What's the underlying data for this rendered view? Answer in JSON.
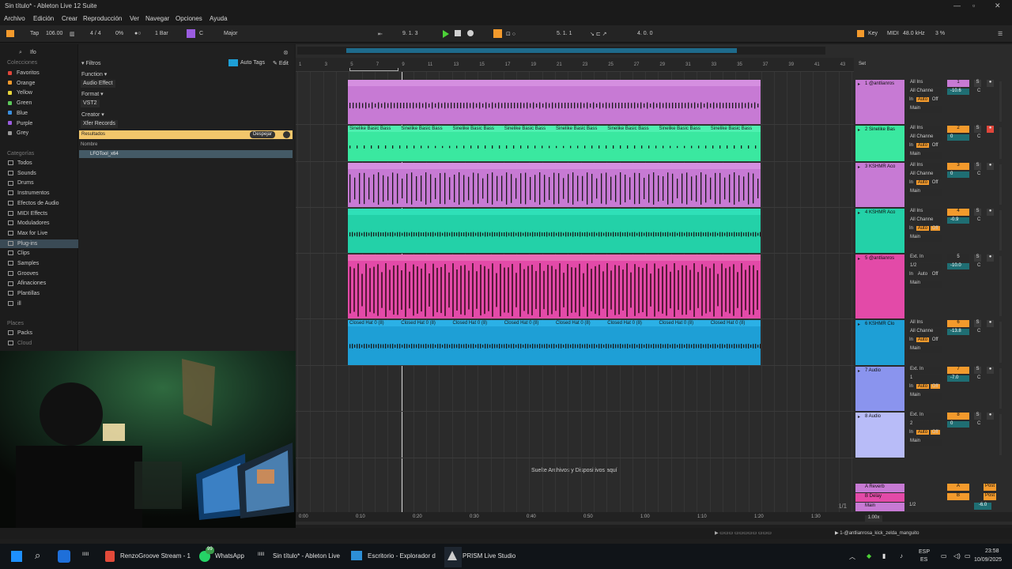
{
  "window": {
    "title": "Sin título* - Ableton Live 12 Suite"
  },
  "menu": [
    "Archivo",
    "Edición",
    "Crear",
    "Reproducción",
    "Ver",
    "Navegar",
    "Opciones",
    "Ayuda"
  ],
  "controlbar": {
    "tap": "Tap",
    "tempo": "106.00",
    "signature": "4 / 4",
    "metronome": "0%",
    "quantize": "1 Bar",
    "key": "C",
    "scale": "Major",
    "position": "9.  1.  3",
    "loop_start": "5.  1.  1",
    "loop_length": "4.  0.  0",
    "key_label": "Key",
    "midi_label": "MIDI",
    "sample_rate": "48.0 kHz",
    "cpu": "3 %"
  },
  "browser": {
    "search_placeholder": "Ifo",
    "collections_header": "Colecciones",
    "collections": [
      {
        "label": "Favoritos",
        "color": "#e0463a"
      },
      {
        "label": "Orange",
        "color": "#f39a2c"
      },
      {
        "label": "Yellow",
        "color": "#e8d43a"
      },
      {
        "label": "Green",
        "color": "#5cc85a"
      },
      {
        "label": "Blue",
        "color": "#3a8fe0"
      },
      {
        "label": "Purple",
        "color": "#9a5ce0"
      },
      {
        "label": "Grey",
        "color": "#9a9a9a"
      }
    ],
    "categories_header": "Categorías",
    "categories": [
      "Todos",
      "Sounds",
      "Drums",
      "Instrumentos",
      "Efectos de Audio",
      "MIDI Effects",
      "Moduladores",
      "Max for Live",
      "Plug-ins",
      "Clips",
      "Samples",
      "Grooves",
      "Afinaciones",
      "Plantillas",
      "ill"
    ],
    "selected_category": "Plug-ins",
    "places_header": "Places",
    "places": [
      "Packs",
      "Cloud"
    ],
    "filters_label": "Filtros",
    "auto_tags": "Auto Tags",
    "edit": "Edit",
    "filter_function": "Function",
    "filter_function_value": "Audio Effect",
    "filter_format": "Format",
    "filter_format_value": "VST2",
    "filter_creator": "Creator",
    "filter_creator_value": "Xfer Records",
    "results_label": "Resultados",
    "clear_button": "Despejar",
    "name_header": "Nombre",
    "result_item": "LFOTool_x64"
  },
  "ruler": [
    "1",
    "3",
    "5",
    "7",
    "9",
    "11",
    "13",
    "15",
    "17",
    "19",
    "21",
    "23",
    "25",
    "27",
    "29",
    "31",
    "33",
    "35",
    "37",
    "39",
    "41",
    "43"
  ],
  "tracks": [
    {
      "name": "1 @antlianros",
      "color": "#c77ad4",
      "input": "All Ins",
      "channel": "All Channe",
      "num": "1",
      "vol": "-10.6",
      "numColor": "#c77ad4",
      "clipLabel": ""
    },
    {
      "name": "2 Sinelike Bas",
      "color": "#3ae8a0",
      "input": "All Ins",
      "channel": "All Channe",
      "num": "2",
      "vol": "0",
      "numColor": "#f39a2c",
      "clipLabel": "Sinelike Basic Bass"
    },
    {
      "name": "3 KSHMR Aco",
      "color": "#c77ad4",
      "input": "All Ins",
      "channel": "All Channe",
      "num": "3",
      "vol": "0",
      "numColor": "#f39a2c",
      "clipLabel": ""
    },
    {
      "name": "4 KSHMR Aco",
      "color": "#23d1a8",
      "input": "All Ins",
      "channel": "All Channe",
      "num": "4",
      "vol": "-0.9",
      "numColor": "#f39a2c",
      "clipLabel": ""
    },
    {
      "name": "5 @antlianros",
      "color": "#e34aa8",
      "input": "Ext. In",
      "channel": "1/2",
      "num": "5",
      "vol": "-10.0",
      "numColor": "#2a2a2a",
      "clipLabel": ""
    },
    {
      "name": "6 KSHMR Clo",
      "color": "#1e9fd6",
      "input": "All Ins",
      "channel": "All Channe",
      "num": "6",
      "vol": "-13.8",
      "numColor": "#f39a2c",
      "clipLabel": "Closed Hat 0 (8)"
    },
    {
      "name": "7 Audio",
      "color": "#8a94ee",
      "input": "Ext. In",
      "channel": "1",
      "num": "7",
      "vol": "-7.0",
      "numColor": "#f39a2c",
      "clipLabel": ""
    },
    {
      "name": "8 Audio",
      "color": "#b8bcf8",
      "input": "Ext. In",
      "channel": "2",
      "num": "8",
      "vol": "0",
      "numColor": "#f39a2c",
      "clipLabel": ""
    }
  ],
  "returns": [
    {
      "name": "A Reverb",
      "color": "#c77ad4",
      "letter": "A"
    },
    {
      "name": "B Delay",
      "color": "#e34aa8",
      "letter": "B"
    },
    {
      "name": "Main",
      "color": "#c77ad4",
      "letter": ""
    }
  ],
  "labels": {
    "output_main": "Main",
    "monitor_in": "In",
    "monitor_auto": "Auto",
    "monitor_off": "Off",
    "set_label": "Set",
    "drop_hint": "Suelte Archivos y Dispositivos aquí",
    "post": "Post",
    "zoom": "1.00x",
    "page": "1/1",
    "main_channel": "1/2",
    "main_vol": "-6.0"
  },
  "timeline": [
    "0:00",
    "0:10",
    "0:20",
    "0:30",
    "0:40",
    "0:50",
    "1:00",
    "1:10",
    "1:20",
    "1:30"
  ],
  "status": {
    "clip_name": "1-@antlianrosa_kick_zelda_manguito"
  },
  "taskbar": {
    "apps": [
      "RenzoGroove Stream - 1",
      "WhatsApp",
      "Sin título* - Ableton Live",
      "Escritorio - Explorador d",
      "PRISM Live Studio"
    ],
    "badge": "99",
    "lang": "ESP",
    "lang2": "ES",
    "time": "23:58",
    "date": "10/09/2025"
  }
}
